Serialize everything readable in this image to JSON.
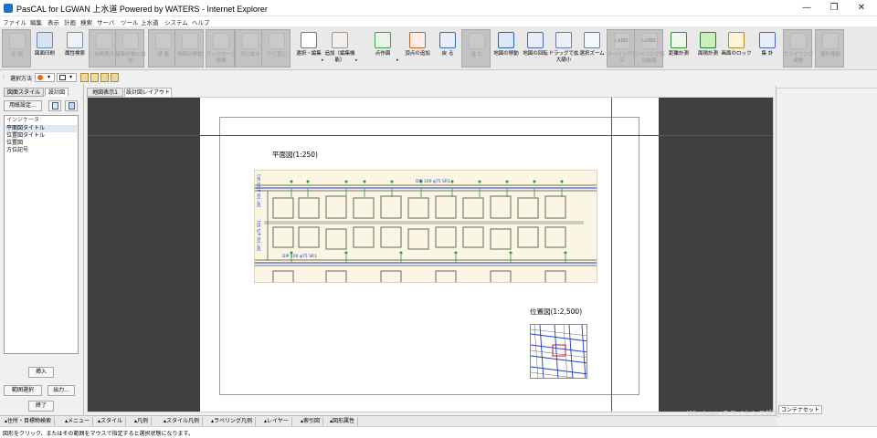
{
  "window": {
    "title": "PasCAL for LGWAN 上水道 Powered by WATERS - Internet Explorer",
    "controls": [
      "—",
      "❐",
      "✕"
    ]
  },
  "menu": [
    "ファイル",
    "編集",
    "表示",
    "計画",
    "検索",
    "サーバ",
    "ツール",
    "上水道",
    "システム",
    "ヘルプ"
  ],
  "toolbar": {
    "buttons": [
      {
        "label": "印 刷",
        "enabled": false
      },
      {
        "label": "図面印刷",
        "enabled": true
      },
      {
        "label": "属性検索",
        "enabled": true
      },
      {
        "label": "台帳表示",
        "enabled": false
      },
      {
        "label": "編集対象に追加",
        "enabled": false
      },
      {
        "label": "移 動",
        "enabled": false
      },
      {
        "label": "地図の移動",
        "enabled": false
      },
      {
        "label": "ブックマーク登録",
        "enabled": false
      },
      {
        "label": "元に戻す",
        "enabled": false
      },
      {
        "label": "やり直し",
        "enabled": false
      },
      {
        "label": "選択・編集",
        "enabled": true
      },
      {
        "label": "追加（編集機能）",
        "enabled": true
      },
      {
        "label": "点作図",
        "enabled": true
      },
      {
        "label": "頂点の追加",
        "enabled": true
      },
      {
        "label": "戻 る",
        "enabled": true
      },
      {
        "label": "進 む",
        "enabled": false
      },
      {
        "label": "地図の移動",
        "enabled": true
      },
      {
        "label": "地図の回転",
        "enabled": true
      },
      {
        "label": "ドラッグで拡大縮小",
        "enabled": true
      },
      {
        "label": "選択ズーム",
        "enabled": true
      },
      {
        "label": "ラベリング表示",
        "enabled": false
      },
      {
        "label": "ラベリング個別編集",
        "enabled": false
      },
      {
        "label": "距離計測",
        "enabled": true
      },
      {
        "label": "面積計測",
        "enabled": true
      },
      {
        "label": "画面のロック",
        "enabled": true
      },
      {
        "label": "集 計",
        "enabled": true
      },
      {
        "label": "ファイリング連動",
        "enabled": false
      },
      {
        "label": "構外連動",
        "enabled": false
      }
    ],
    "icon_labels": {
      "label1": "LABEL",
      "label2": "LABEL"
    }
  },
  "selection_bar": {
    "label": "選択方法",
    "mode_icons": [
      "▾",
      "▾"
    ]
  },
  "left_panel": {
    "tabs": [
      "図面スタイル",
      "設計図"
    ],
    "active_tab": 1,
    "settings_button": "用紙設定...",
    "group_label": "インジケータ",
    "items": [
      "平面図タイトル",
      "位置図タイトル",
      "位置図",
      "方位記号"
    ],
    "selected_index": 0,
    "insert_button": "挿入",
    "range_button": "範囲選択",
    "output_button": "出力...",
    "exit_button": "終了"
  },
  "doc_tabs": [
    "地図表示1",
    "設計図レイアウト"
  ],
  "doc_active_tab": 1,
  "layout": {
    "plan_title": "平面図(1:250)",
    "location_title": "位置図(1:2,500)",
    "pipe_label_1": "DIP 100 φ75 SR1",
    "pipe_label_2": "DIP 100 φ75 SR1",
    "pipe_label_vert_1": "DIP 100 φ100 SR1",
    "pipe_label_vert_2": "DIP 100 φ75 SR1"
  },
  "right_panel": {
    "tab_label": "コンテナセット"
  },
  "bottom_tabs": [
    "住所・目標物検索",
    "メニュー",
    "スタイル",
    "凡例",
    "スタイル凡例",
    "ラベリング凡例",
    "レイヤー",
    "索引図",
    "図形属性"
  ],
  "status": {
    "text": "図形をクリック、またはその範囲をマウスで指定すると選択状態になります。"
  },
  "watermark": {
    "line1": "Windows のライセンス認証"
  },
  "colors": {
    "titlebar": "#ffffff",
    "toolbar": "#e9e9e9",
    "paper_dark": "#3f3f3f",
    "map_bg": "#faf6e3",
    "pipe_blue": "#1a3cc8",
    "pipe_green": "#2e9a36",
    "accent_red": "#d01010"
  }
}
